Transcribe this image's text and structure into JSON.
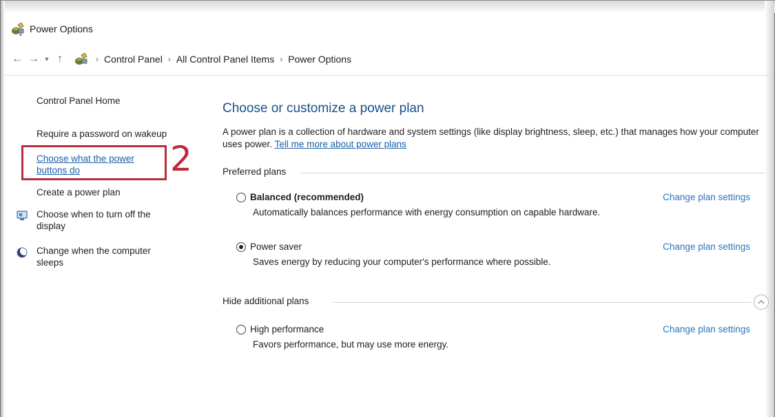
{
  "window": {
    "title": "Power Options",
    "icon": "power-options-icon"
  },
  "nav": {
    "back_icon": "back-arrow-icon",
    "forward_icon": "forward-arrow-icon",
    "recent_icon": "chevron-down-icon",
    "up_icon": "up-arrow-icon",
    "breadcrumb": [
      "Control Panel",
      "All Control Panel Items",
      "Power Options"
    ]
  },
  "sidebar": {
    "home": "Control Panel Home",
    "items": [
      {
        "label": "Require a password on wakeup",
        "icon": ""
      },
      {
        "label": "Choose what the power buttons do",
        "line1": "Choose what the power",
        "line2": "buttons do",
        "icon": ""
      },
      {
        "label": "Create a power plan",
        "icon": ""
      },
      {
        "label": "Choose when to turn off the display",
        "line1": "Choose when to turn off the",
        "line2": "display",
        "icon": "monitor-icon"
      },
      {
        "label": "Change when the computer sleeps",
        "line1": "Change when the computer",
        "line2": "sleeps",
        "icon": "moon-icon"
      }
    ]
  },
  "annotation": {
    "number": "2",
    "color": "#c0283a"
  },
  "main": {
    "heading": "Choose or customize a power plan",
    "description": "A power plan is a collection of hardware and system settings (like display brightness, sleep, etc.) that manages how your computer uses power.",
    "learn_more": "Tell me more about power plans",
    "preferred_label": "Preferred plans",
    "additional_label": "Hide additional plans",
    "collapse_icon": "chevron-up-circle-icon",
    "plans": [
      {
        "name": "Balanced (recommended)",
        "description": "Automatically balances performance with energy consumption on capable hardware.",
        "link": "Change plan settings",
        "selected": false
      },
      {
        "name": "Power saver",
        "description": "Saves energy by reducing your computer's performance where possible.",
        "link": "Change plan settings",
        "selected": true
      },
      {
        "name": "High performance",
        "description": "Favors performance, but may use more energy.",
        "link": "Change plan settings",
        "selected": false
      }
    ]
  },
  "colors": {
    "link": "#1a5fa8",
    "heading": "#1a4e8c",
    "annotation": "#b82b3a"
  }
}
